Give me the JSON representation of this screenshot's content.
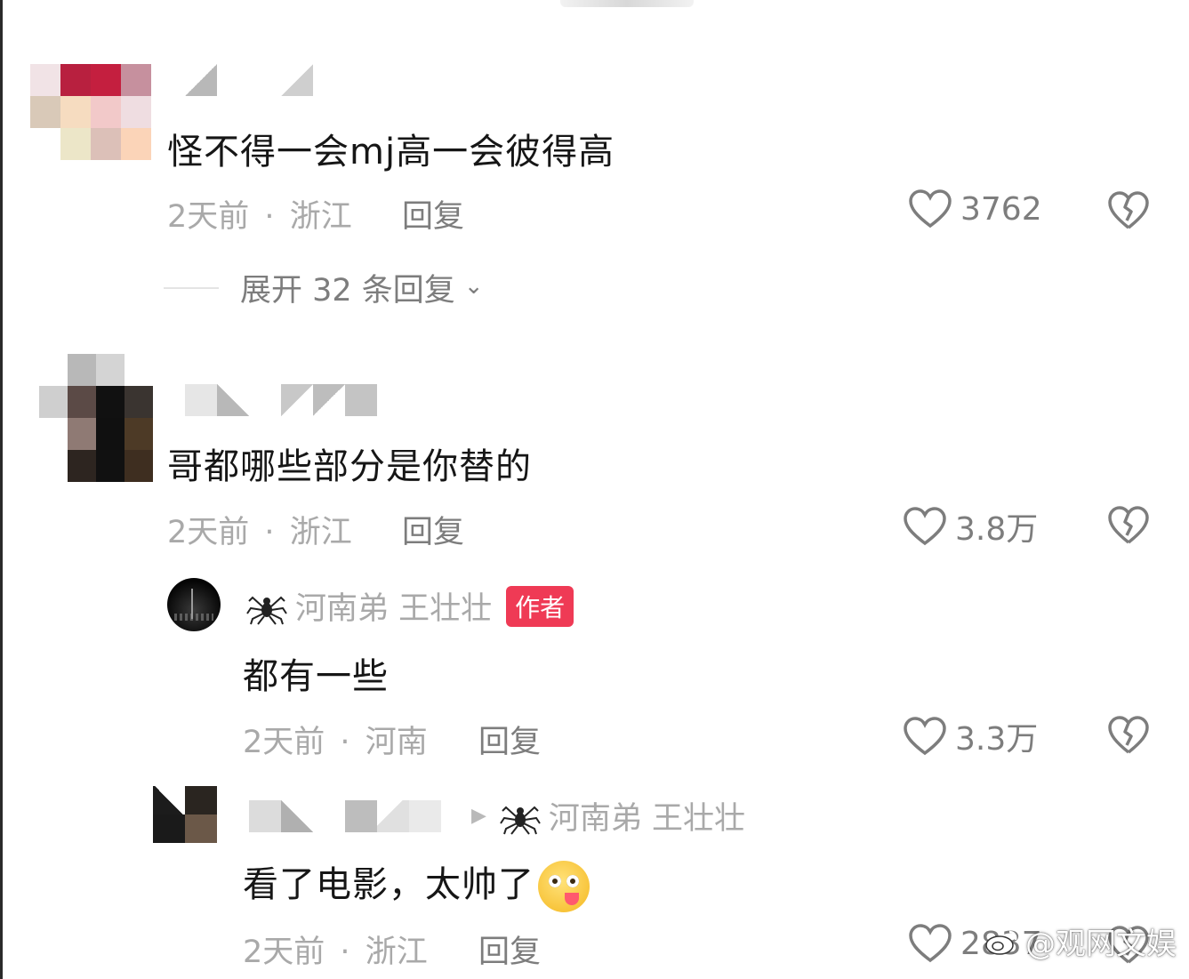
{
  "comments": [
    {
      "text": "怪不得一会mj高一会彼得高",
      "time": "2天前",
      "location": "浙江",
      "reply_label": "回复",
      "likes": "3762",
      "expand_label": "展开 32 条回复"
    },
    {
      "text": "哥都哪些部分是你替的",
      "time": "2天前",
      "location": "浙江",
      "reply_label": "回复",
      "likes": "3.8万"
    }
  ],
  "replies": [
    {
      "username": "河南弟 王壮壮",
      "badge": "作者",
      "text": "都有一些",
      "time": "2天前",
      "location": "河南",
      "reply_label": "回复",
      "likes": "3.3万"
    },
    {
      "reply_to": "河南弟 王壮壮",
      "text": "看了电影，太帅了",
      "emoji": "drooling-star-eyes-emoji",
      "time": "2天前",
      "location": "浙江",
      "reply_label": "回复",
      "likes": "2837"
    }
  ],
  "separator": "·",
  "watermark": "@观网文娱",
  "colors": {
    "text_primary": "#161616",
    "text_meta": "#a9a9a9",
    "text_action": "#7d7d7d",
    "author_badge": "#ef3a55"
  },
  "icons": [
    "heart-outline-icon",
    "broken-heart-icon",
    "spider-icon",
    "chevron-down-icon",
    "reply-arrow-icon",
    "weibo-logo-icon"
  ]
}
